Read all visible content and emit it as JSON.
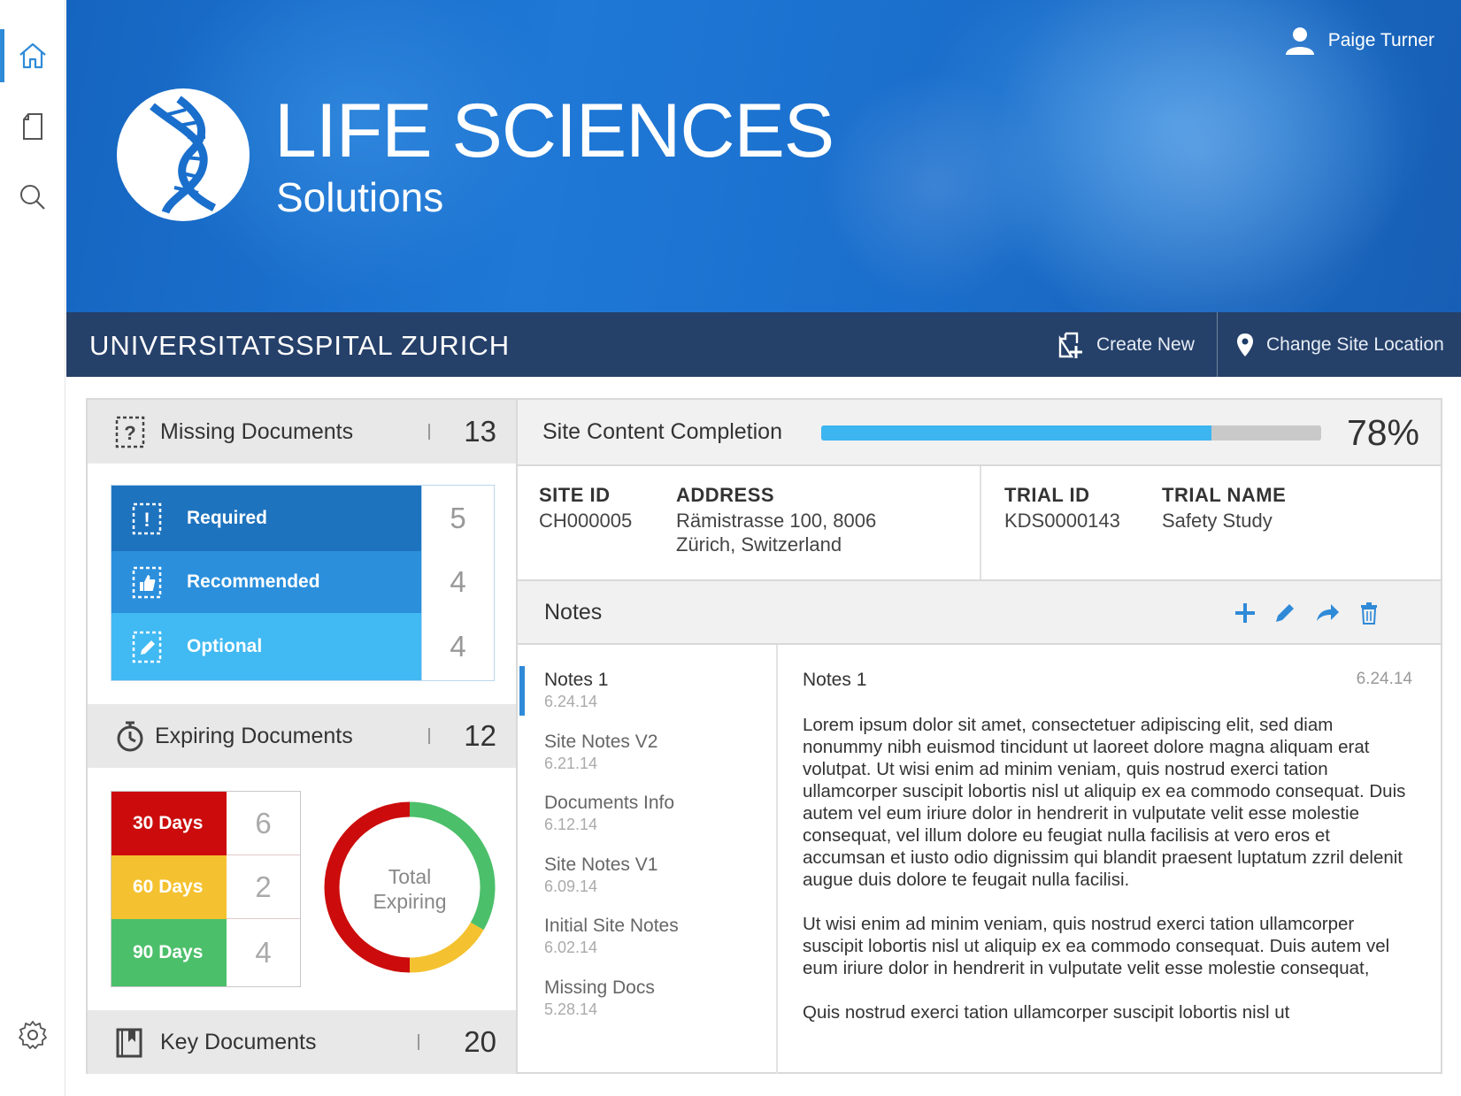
{
  "sidebar": {
    "items": [
      {
        "icon": "home-icon"
      },
      {
        "icon": "document-icon"
      },
      {
        "icon": "search-icon"
      },
      {
        "icon": "gear-icon"
      }
    ]
  },
  "header": {
    "user_name": "Paige Turner",
    "logo_title": "LIFE SCIENCES",
    "logo_subtitle": "Solutions",
    "site_name": "UNIVERSITATSSPITAL ZURICH",
    "create_new_label": "Create New",
    "change_site_label": "Change Site Location"
  },
  "missing_documents": {
    "title": "Missing Documents",
    "count": "13",
    "rows": [
      {
        "label": "Required",
        "value": "5",
        "color": "#1e73be"
      },
      {
        "label": "Recommended",
        "value": "4",
        "color": "#2b8fdc"
      },
      {
        "label": "Optional",
        "value": "4",
        "color": "#41b9f2"
      }
    ]
  },
  "expiring_documents": {
    "title": "Expiring Documents",
    "count": "12",
    "rows": [
      {
        "label": "30 Days",
        "value": "6",
        "color": "#cc0c0c"
      },
      {
        "label": "60 Days",
        "value": "2",
        "color": "#f4c230"
      },
      {
        "label": "90 Days",
        "value": "4",
        "color": "#4cbf6a"
      }
    ],
    "donut_label_line1": "Total",
    "donut_label_line2": "Expiring"
  },
  "key_documents": {
    "title": "Key Documents",
    "count": "20"
  },
  "completion": {
    "title": "Site Content Completion",
    "percent_value": 0.78,
    "percent_label": "78%"
  },
  "site_info": {
    "site_id_label": "SITE ID",
    "site_id": "CH000005",
    "address_label": "ADDRESS",
    "address": "Rämistrasse 100, 8006\nZürich, Switzerland",
    "trial_id_label": "TRIAL ID",
    "trial_id": "KDS0000143",
    "trial_name_label": "TRIAL NAME",
    "trial_name": "Safety Study"
  },
  "notes": {
    "title": "Notes",
    "actions": [
      "add-icon",
      "edit-icon",
      "share-icon",
      "trash-icon"
    ],
    "list": [
      {
        "title": "Notes 1",
        "date": "6.24.14"
      },
      {
        "title": "Site Notes V2",
        "date": "6.21.14"
      },
      {
        "title": "Documents Info",
        "date": "6.12.14"
      },
      {
        "title": "Site Notes V1",
        "date": "6.09.14"
      },
      {
        "title": "Initial Site Notes",
        "date": "6.02.14"
      },
      {
        "title": "Missing Docs",
        "date": "5.28.14"
      }
    ],
    "selected": {
      "title": "Notes 1",
      "date": "6.24.14",
      "paragraphs": [
        "Lorem ipsum dolor sit amet, consectetuer adipiscing elit, sed diam nonummy nibh euismod tincidunt ut laoreet dolore magna aliquam erat volutpat. Ut wisi enim ad minim veniam, quis nostrud exerci tation ullamcorper suscipit lobortis nisl ut aliquip ex ea commodo consequat. Duis autem vel eum iriure dolor in hendrerit in vulputate velit esse molestie consequat, vel illum dolore eu feugiat nulla facilisis at vero eros et accumsan et iusto odio dignissim qui blandit praesent luptatum zzril delenit augue duis dolore te feugait nulla facilisi.",
        "Ut wisi enim ad minim veniam, quis nostrud exerci tation ullamcorper suscipit lobortis nisl ut aliquip ex ea commodo consequat. Duis autem vel eum iriure dolor in hendrerit in vulputate velit esse molestie consequat,",
        "Quis nostrud exerci tation ullamcorper suscipit lobortis nisl ut"
      ]
    }
  }
}
